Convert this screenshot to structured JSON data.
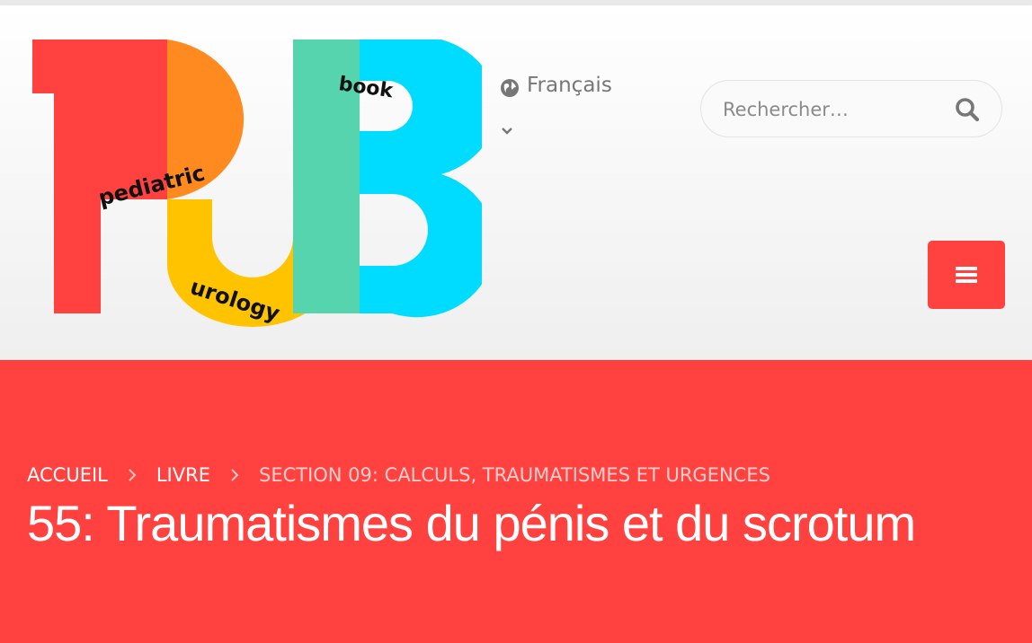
{
  "header": {
    "logo": {
      "letters": [
        "P",
        "U",
        "B"
      ],
      "words": [
        "pediatric",
        "urology",
        "book"
      ],
      "colors": [
        "#ff423f",
        "#ff8b20",
        "#ffc300",
        "#55d4ae",
        "#00dcff"
      ]
    },
    "language": {
      "label": "Français",
      "icon": "globe-icon"
    },
    "search": {
      "placeholder": "Rechercher…",
      "icon": "search-icon"
    },
    "menu": {
      "icon": "hamburger-menu-icon",
      "color": "#ff423f"
    }
  },
  "hero": {
    "background": "#ff423f",
    "breadcrumb": [
      "ACCUEIL",
      "LIVRE",
      "SECTION 09: CALCULS, TRAUMATISMES ET URGENCES"
    ],
    "title": "55: Traumatismes du pénis et du scrotum"
  }
}
